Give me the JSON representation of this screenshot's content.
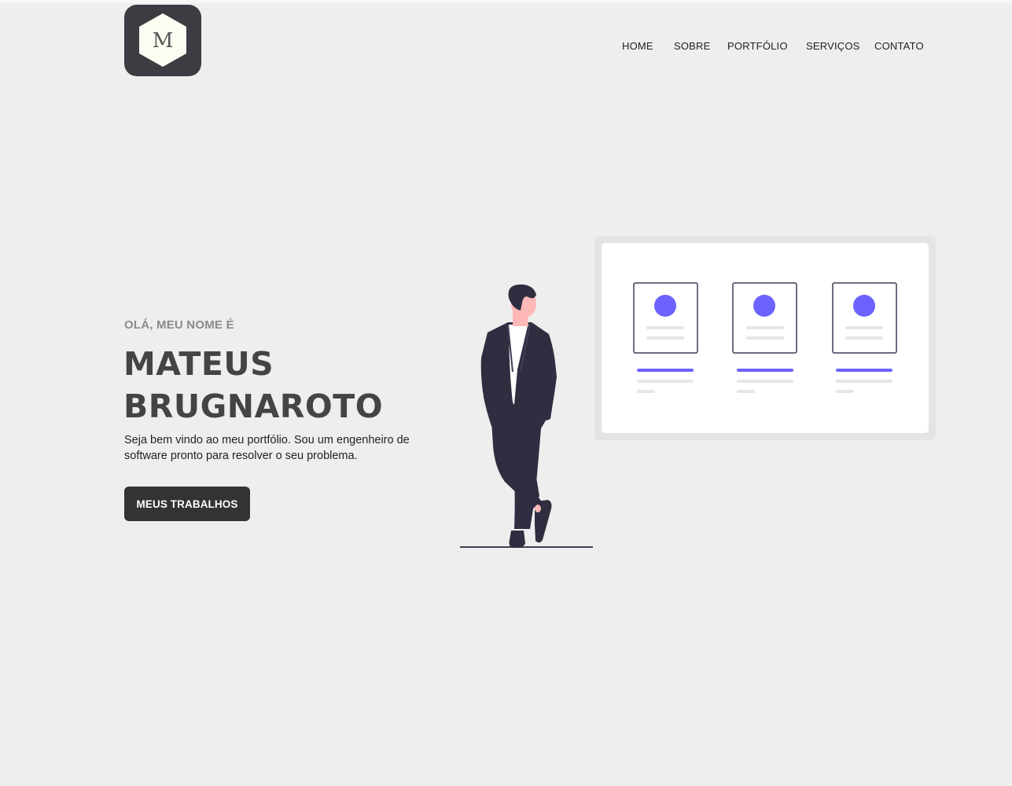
{
  "header": {
    "logo_letter": "M",
    "nav": [
      {
        "label": "HOME"
      },
      {
        "label": "SOBRE"
      },
      {
        "label": "PORTFÓLIO"
      },
      {
        "label": "SERVIÇOS"
      },
      {
        "label": "CONTATO"
      }
    ]
  },
  "hero": {
    "eyebrow": "OLÁ, MEU NOME É",
    "name_line1": "MATEUS",
    "name_line2": "BRUGNAROTO",
    "intro": "Seja bem vindo ao meu portfólio. Sou um engenheiro de software pronto para resolver o seu problema.",
    "cta_label": "MEUS TRABALHOS"
  },
  "colors": {
    "background": "#eeeeee",
    "logo_bg": "#3b3d43",
    "accent": "#6c63ff",
    "text_dark": "#444444",
    "button_bg": "#333333"
  }
}
